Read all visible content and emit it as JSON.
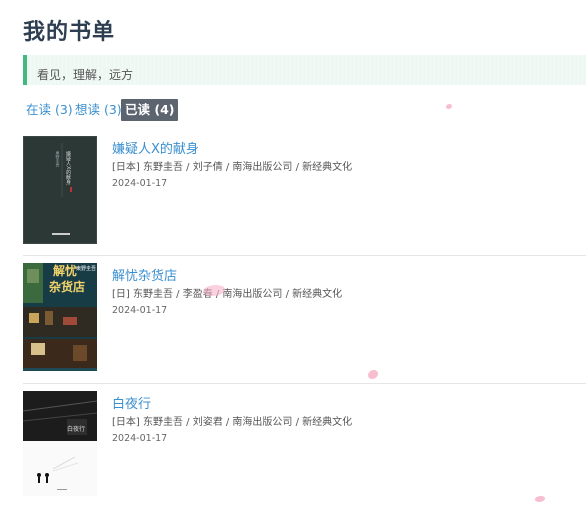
{
  "page": {
    "title": "我的书单"
  },
  "quote": {
    "text": "看见，理解，远方"
  },
  "tabs": [
    {
      "label": "在读 (3)",
      "active": false
    },
    {
      "label": "想读 (3)",
      "active": false
    },
    {
      "label": "已读 (4)",
      "active": true
    }
  ],
  "books": [
    {
      "title": "嫌疑人X的献身",
      "meta": "[日本] 东野圭吾 / 刘子倩 / 南海出版公司 / 新经典文化",
      "date": "2024-01-17",
      "cover_color": "#2d3a38",
      "cover_text": "嫌疑人X的献身"
    },
    {
      "title": "解忧杂货店",
      "meta": "[日] 东野圭吾 / 李盈春 / 南海出版公司 / 新经典文化",
      "date": "2024-01-17",
      "cover_color": "#1f4a55",
      "cover_text": "解忧杂货店",
      "cover_author": "東野圭吾"
    },
    {
      "title": "白夜行",
      "meta": "[日本] 东野圭吾 / 刘姿君 / 南海出版公司 / 新经典文化",
      "date": "2024-01-17",
      "cover_color": "#222222",
      "cover_text": "白夜行"
    }
  ]
}
